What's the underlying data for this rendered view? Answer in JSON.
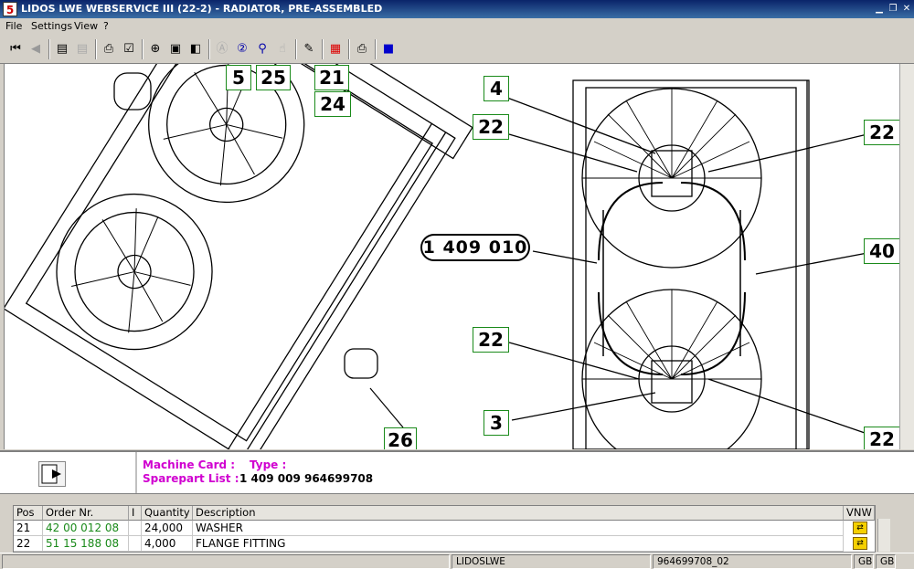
{
  "window": {
    "title": "LIDOS LWE WEBSERVICE III (22-2) - RADIATOR, PRE-ASSEMBLED",
    "icon_text": "5"
  },
  "menu": [
    "File",
    "Settings",
    "View",
    "?"
  ],
  "toolbar_icons": [
    "first-page-icon",
    "previous-icon",
    "book-open-icon",
    "book-disabled-icon",
    "printer-list-icon",
    "checklist-icon",
    "zoom-icon",
    "page-icon",
    "page-alt-icon",
    "circle-a-icon",
    "circle-2-icon",
    "search-parts-icon",
    "pointer-disabled-icon",
    "edit-icon",
    "grid-icon",
    "print-icon",
    "blue-square-icon"
  ],
  "drawing": {
    "callouts": [
      "5",
      "25",
      "21",
      "24",
      "26",
      "4",
      "22",
      "22",
      "40",
      "22",
      "3",
      "22"
    ],
    "assembly_pill": "1 409 010"
  },
  "info": {
    "machine_card_label": "Machine Card :",
    "type_label": "Type :",
    "sparepart_list_label": "Sparepart List :",
    "sparepart_list_value": "1 409 009 964699708"
  },
  "table": {
    "headers": [
      "Pos",
      "Order Nr.",
      "I",
      "Quantity",
      "Description",
      "VNW"
    ],
    "rows": [
      {
        "pos": "21",
        "order": "42 00 012 08",
        "i": "",
        "qty": "24,000",
        "desc": "WASHER"
      },
      {
        "pos": "22",
        "order": "51 15 188 08",
        "i": "",
        "qty": "4,000",
        "desc": "FLANGE FITTING"
      }
    ]
  },
  "status": {
    "app": "LIDOSLWE",
    "doc": "964699708_02",
    "lang1": "GB",
    "lang2": "GB"
  },
  "colors": {
    "title_gradient_start": "#0a246a",
    "callout_border": "#1a8a1a",
    "label_magenta": "#d000d0",
    "order_green": "#1a8a1a"
  }
}
